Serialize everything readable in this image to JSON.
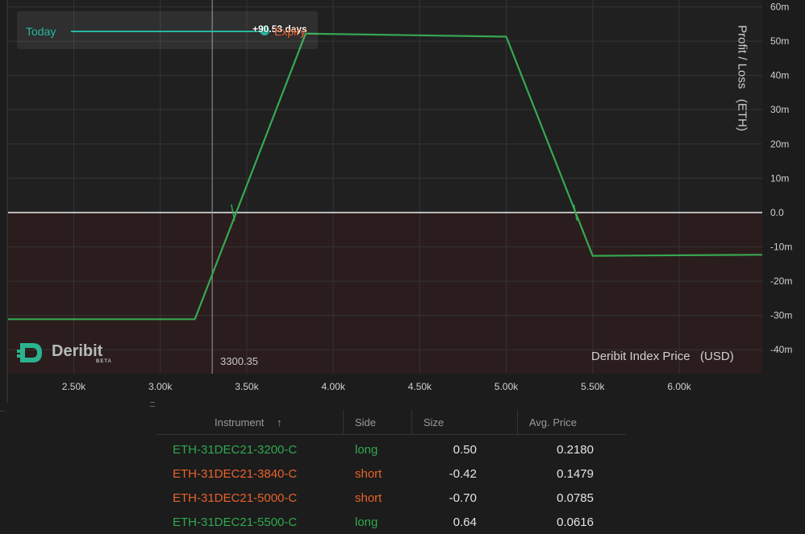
{
  "colors": {
    "background": "#1c1c1c",
    "plot_background": "#202020",
    "loss_zone": "#2b1d1d",
    "grid": "#343434",
    "curve": "#36a852",
    "long": "#2fa84f",
    "short": "#e8622b",
    "slider": "#26b8a0",
    "axis_text": "#d0d0d0"
  },
  "slider": {
    "start_label": "Today",
    "end_label": "Expiry",
    "value_label": "+90.53 days"
  },
  "logo": {
    "name": "Deribit",
    "badge": "BETA"
  },
  "crosshair": {
    "x": 3300.35,
    "label": "3300.35"
  },
  "chart_data": {
    "type": "line",
    "xlabel": "Deribit Index Price   (USD)",
    "ylabel": "Profit / Loss   (ETH)",
    "xlim": [
      2120,
      6480
    ],
    "ylim": [
      -47,
      62
    ],
    "x_ticks": [
      2500,
      3000,
      3500,
      4000,
      4500,
      5000,
      5500,
      6000
    ],
    "x_tick_labels": [
      "2.50k",
      "3.00k",
      "3.50k",
      "4.00k",
      "4.50k",
      "5.00k",
      "5.50k",
      "6.00k"
    ],
    "y_ticks": [
      60,
      50,
      40,
      30,
      20,
      10,
      0,
      -10,
      -20,
      -30,
      -40
    ],
    "y_tick_labels": [
      "60m",
      "50m",
      "40m",
      "30m",
      "20m",
      "10m",
      "0.0",
      "-10m",
      "-20m",
      "-30m",
      "-40m"
    ],
    "series": [
      {
        "x": [
          2120,
          3200,
          3840,
          5000,
          5500,
          6480
        ],
        "y": [
          -31.1,
          -31.1,
          52.2,
          51.3,
          -12.6,
          -12.3
        ]
      }
    ],
    "breakeven_x": [
      3420,
      5400
    ],
    "grid": true,
    "legend": "none"
  },
  "table": {
    "headers": {
      "instrument": "Instrument",
      "sort_icon": "↑",
      "side": "Side",
      "size": "Size",
      "avg_price": "Avg. Price"
    },
    "rows": [
      {
        "instrument": "ETH-31DEC21-3200-C",
        "side": "long",
        "size": "0.50",
        "avg_price": "0.2180"
      },
      {
        "instrument": "ETH-31DEC21-3840-C",
        "side": "short",
        "size": "-0.42",
        "avg_price": "0.1479"
      },
      {
        "instrument": "ETH-31DEC21-5000-C",
        "side": "short",
        "size": "-0.70",
        "avg_price": "0.0785"
      },
      {
        "instrument": "ETH-31DEC21-5500-C",
        "side": "long",
        "size": "0.64",
        "avg_price": "0.0616"
      }
    ]
  }
}
